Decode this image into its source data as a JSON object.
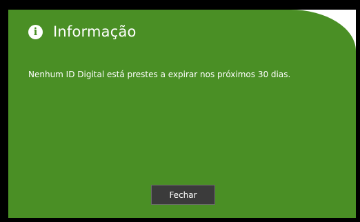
{
  "dialog": {
    "icon": "info-icon",
    "icon_glyph": "i",
    "title": "Informação",
    "message": "Nenhum ID Digital está prestes a expirar nos próximos 30 dias.",
    "close_label": "Fechar",
    "colors": {
      "background": "#4a8f25",
      "button": "#3b3b3b",
      "text": "#ffffff"
    }
  }
}
